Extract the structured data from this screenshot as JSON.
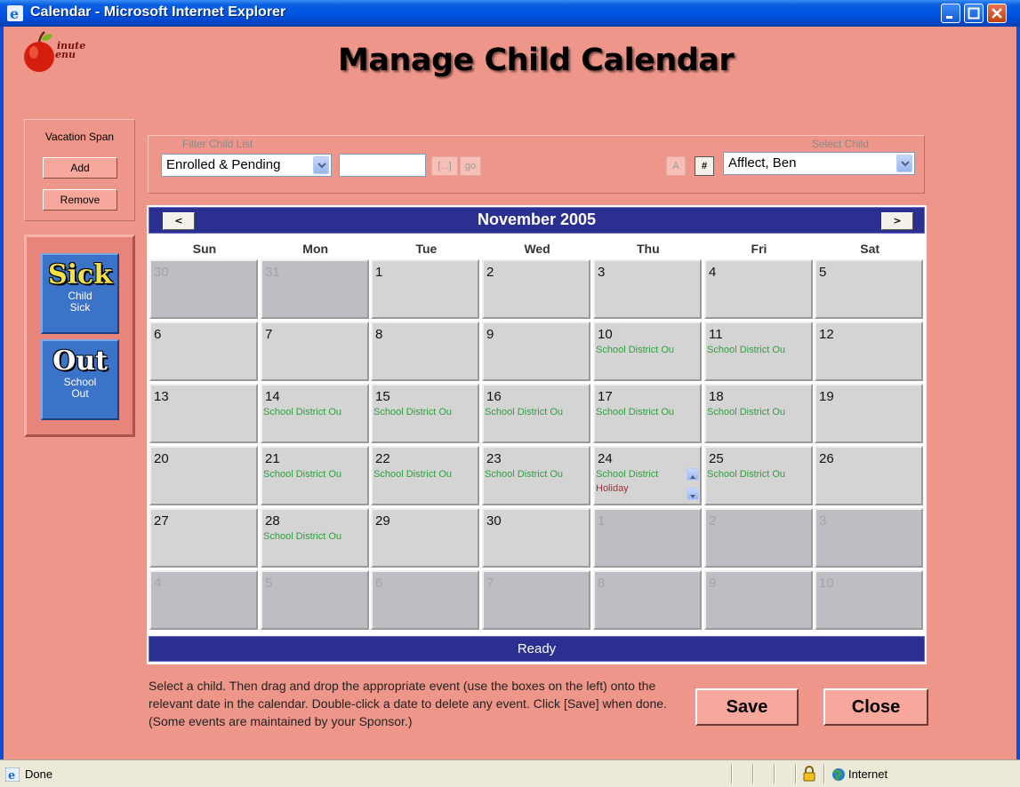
{
  "window": {
    "title": "Calendar - Microsoft Internet Explorer"
  },
  "logo": {
    "line1": "inute",
    "line2": "enu"
  },
  "page": {
    "title": "Manage Child Calendar"
  },
  "vacation": {
    "title": "Vacation Span",
    "add_label": "Add",
    "remove_label": "Remove"
  },
  "events": {
    "sick": {
      "big": "Sick",
      "line1": "Child",
      "line2": "Sick"
    },
    "out": {
      "big": "Out",
      "line1": "School",
      "line2": "Out"
    }
  },
  "filter": {
    "filter_label": "Filter Child List",
    "filter_value": "Enrolled & Pending",
    "search_value": "",
    "browse_label": "[...]",
    "go_label": "go",
    "select_label": "Select Child",
    "alpha_label": "A",
    "number_label": "#",
    "child_value": "Afflect, Ben"
  },
  "calendar": {
    "month": "November 2005",
    "prev_label": "<",
    "next_label": ">",
    "days_of_week": [
      "Sun",
      "Mon",
      "Tue",
      "Wed",
      "Thu",
      "Fri",
      "Sat"
    ],
    "weeks": [
      [
        {
          "day": "30",
          "other": true,
          "event": "",
          "event2": ""
        },
        {
          "day": "31",
          "other": true,
          "event": "",
          "event2": ""
        },
        {
          "day": "1",
          "other": false,
          "event": "",
          "event2": ""
        },
        {
          "day": "2",
          "other": false,
          "event": "",
          "event2": ""
        },
        {
          "day": "3",
          "other": false,
          "event": "",
          "event2": ""
        },
        {
          "day": "4",
          "other": false,
          "event": "",
          "event2": ""
        },
        {
          "day": "5",
          "other": false,
          "event": "",
          "event2": ""
        }
      ],
      [
        {
          "day": "6",
          "other": false,
          "event": "",
          "event2": ""
        },
        {
          "day": "7",
          "other": false,
          "event": "",
          "event2": ""
        },
        {
          "day": "8",
          "other": false,
          "event": "",
          "event2": ""
        },
        {
          "day": "9",
          "other": false,
          "event": "",
          "event2": ""
        },
        {
          "day": "10",
          "other": false,
          "event": "School District Ou",
          "event2": ""
        },
        {
          "day": "11",
          "other": false,
          "event": "School District Ou",
          "event2": ""
        },
        {
          "day": "12",
          "other": false,
          "event": "",
          "event2": ""
        }
      ],
      [
        {
          "day": "13",
          "other": false,
          "event": "",
          "event2": ""
        },
        {
          "day": "14",
          "other": false,
          "event": "School District Ou",
          "event2": ""
        },
        {
          "day": "15",
          "other": false,
          "event": "School District Ou",
          "event2": ""
        },
        {
          "day": "16",
          "other": false,
          "event": "School District Ou",
          "event2": ""
        },
        {
          "day": "17",
          "other": false,
          "event": "School District Ou",
          "event2": ""
        },
        {
          "day": "18",
          "other": false,
          "event": "School District Ou",
          "event2": ""
        },
        {
          "day": "19",
          "other": false,
          "event": "",
          "event2": ""
        }
      ],
      [
        {
          "day": "20",
          "other": false,
          "event": "",
          "event2": ""
        },
        {
          "day": "21",
          "other": false,
          "event": "School District Ou",
          "event2": ""
        },
        {
          "day": "22",
          "other": false,
          "event": "School District Ou",
          "event2": ""
        },
        {
          "day": "23",
          "other": false,
          "event": "School District Ou",
          "event2": ""
        },
        {
          "day": "24",
          "other": false,
          "event": "School District",
          "event2": "Holiday",
          "scroll": true
        },
        {
          "day": "25",
          "other": false,
          "event": "School District Ou",
          "event2": ""
        },
        {
          "day": "26",
          "other": false,
          "event": "",
          "event2": ""
        }
      ],
      [
        {
          "day": "27",
          "other": false,
          "event": "",
          "event2": ""
        },
        {
          "day": "28",
          "other": false,
          "event": "School District Ou",
          "event2": ""
        },
        {
          "day": "29",
          "other": false,
          "event": "",
          "event2": ""
        },
        {
          "day": "30",
          "other": false,
          "event": "",
          "event2": ""
        },
        {
          "day": "1",
          "other": true,
          "event": "",
          "event2": ""
        },
        {
          "day": "2",
          "other": true,
          "event": "",
          "event2": ""
        },
        {
          "day": "3",
          "other": true,
          "event": "",
          "event2": ""
        }
      ],
      [
        {
          "day": "4",
          "other": true,
          "event": "",
          "event2": ""
        },
        {
          "day": "5",
          "other": true,
          "event": "",
          "event2": ""
        },
        {
          "day": "6",
          "other": true,
          "event": "",
          "event2": ""
        },
        {
          "day": "7",
          "other": true,
          "event": "",
          "event2": ""
        },
        {
          "day": "8",
          "other": true,
          "event": "",
          "event2": ""
        },
        {
          "day": "9",
          "other": true,
          "event": "",
          "event2": ""
        },
        {
          "day": "10",
          "other": true,
          "event": "",
          "event2": ""
        }
      ]
    ],
    "status": "Ready"
  },
  "instructions": "Select a child. Then drag and drop the appropriate event (use the boxes on the left) onto the relevant date in the calendar. Double-click a date to delete any event. Click [Save] when done. (Some events are maintained by your Sponsor.)",
  "actions": {
    "save_label": "Save",
    "close_label": "Close"
  },
  "statusbar": {
    "text": "Done",
    "zone": "Internet"
  }
}
